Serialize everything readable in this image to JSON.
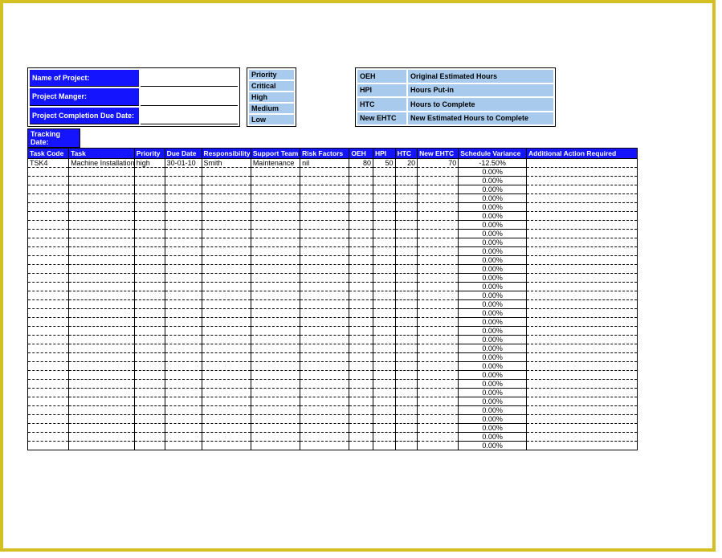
{
  "projectInfo": {
    "nameLabel": "Name of Project:",
    "nameValue": "",
    "managerLabel": "Project Manger:",
    "managerValue": "",
    "dueDateLabel": "Project Completion Due Date:",
    "dueDateValue": ""
  },
  "priority": {
    "header": "Priority",
    "levels": [
      "Critical",
      "High",
      "Medium",
      "Low"
    ]
  },
  "legend": [
    {
      "abbr": "OEH",
      "desc": "Original Estimated Hours"
    },
    {
      "abbr": "HPI",
      "desc": "Hours Put-in"
    },
    {
      "abbr": "HTC",
      "desc": "Hours to Complete"
    },
    {
      "abbr": "New EHTC",
      "desc": "New Estimated Hours to Complete"
    }
  ],
  "trackingDateLabel": "Tracking Date:",
  "columns": {
    "taskCode": "Task Code",
    "task": "Task",
    "priority": "Priority",
    "dueDate": "Due Date",
    "responsibility": "Responsibility",
    "supportTeam": "Support Team",
    "riskFactors": "Risk Factors",
    "oeh": "OEH",
    "hpi": "HPI",
    "htc": "HTC",
    "newEhtc": "New EHTC",
    "scheduleVariance": "Schedule Variance",
    "additionalAction": "Additional Action Required"
  },
  "rows": [
    {
      "taskCode": "TSK4",
      "task": "Machine Installation",
      "priority": "high",
      "dueDate": "30-01-10",
      "responsibility": "Smith",
      "supportTeam": "Maintenance",
      "riskFactors": "nil",
      "oeh": "80",
      "hpi": "50",
      "htc": "20",
      "newEhtc": "70",
      "variance": "-12.50%",
      "action": ""
    },
    {
      "variance": "0.00%"
    },
    {
      "variance": "0.00%"
    },
    {
      "variance": "0.00%"
    },
    {
      "variance": "0.00%"
    },
    {
      "variance": "0.00%"
    },
    {
      "variance": "0.00%"
    },
    {
      "variance": "0.00%"
    },
    {
      "variance": "0.00%"
    },
    {
      "variance": "0.00%"
    },
    {
      "variance": "0.00%"
    },
    {
      "variance": "0.00%"
    },
    {
      "variance": "0.00%"
    },
    {
      "variance": "0.00%"
    },
    {
      "variance": "0.00%"
    },
    {
      "variance": "0.00%"
    },
    {
      "variance": "0.00%"
    },
    {
      "variance": "0.00%"
    },
    {
      "variance": "0.00%"
    },
    {
      "variance": "0.00%"
    },
    {
      "variance": "0.00%"
    },
    {
      "variance": "0.00%"
    },
    {
      "variance": "0.00%"
    },
    {
      "variance": "0.00%"
    },
    {
      "variance": "0.00%"
    },
    {
      "variance": "0.00%"
    },
    {
      "variance": "0.00%"
    },
    {
      "variance": "0.00%"
    },
    {
      "variance": "0.00%"
    },
    {
      "variance": "0.00%"
    },
    {
      "variance": "0.00%"
    },
    {
      "variance": "0.00%"
    },
    {
      "variance": "0.00%"
    }
  ]
}
